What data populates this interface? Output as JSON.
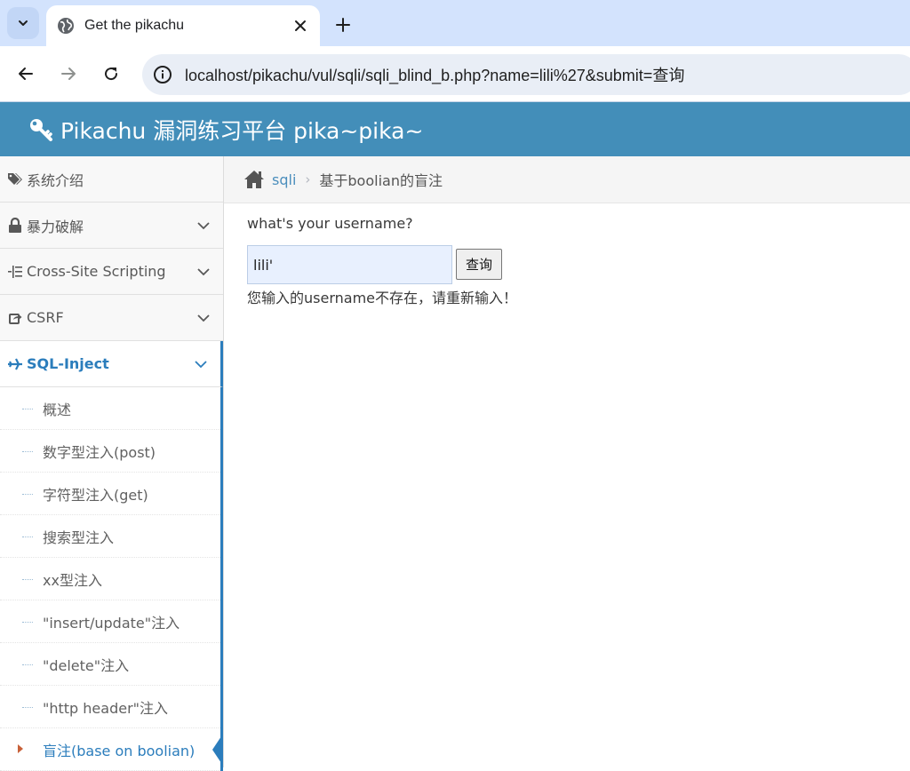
{
  "browser": {
    "tab_title": "Get the pikachu",
    "url": "localhost/pikachu/vul/sqli/sqli_blind_b.php?name=lili%27&submit=查询"
  },
  "header": {
    "title": "Pikachu 漏洞练习平台 pika~pika~",
    "icon": "key-icon"
  },
  "sidebar": {
    "items": [
      {
        "label": "系统介绍",
        "icon": "tags-icon",
        "expandable": false
      },
      {
        "label": "暴力破解",
        "icon": "lock-icon",
        "expandable": true
      },
      {
        "label": "Cross-Site Scripting",
        "icon": "list-indent-icon",
        "expandable": true
      },
      {
        "label": "CSRF",
        "icon": "share-square-icon",
        "expandable": true
      },
      {
        "label": "SQL-Inject",
        "icon": "plane-icon",
        "expandable": true,
        "active": true
      }
    ],
    "submenu": [
      {
        "label": "概述"
      },
      {
        "label": "数字型注入(post)"
      },
      {
        "label": "字符型注入(get)"
      },
      {
        "label": "搜索型注入"
      },
      {
        "label": "xx型注入"
      },
      {
        "label": "\"insert/update\"注入"
      },
      {
        "label": "\"delete\"注入"
      },
      {
        "label": "\"http header\"注入"
      },
      {
        "label": "盲注(base on boolian)",
        "current": true
      }
    ]
  },
  "breadcrumb": {
    "link": "sqli",
    "current": "基于boolian的盲注"
  },
  "main": {
    "question": "what's your username?",
    "input_value": "lili'",
    "submit_label": "查询",
    "result": "您输入的username不存在，请重新输入！"
  },
  "colors": {
    "header_bg": "#438eb9",
    "accent": "#2b7dbc",
    "tabstrip_bg": "#d3e3fd"
  }
}
